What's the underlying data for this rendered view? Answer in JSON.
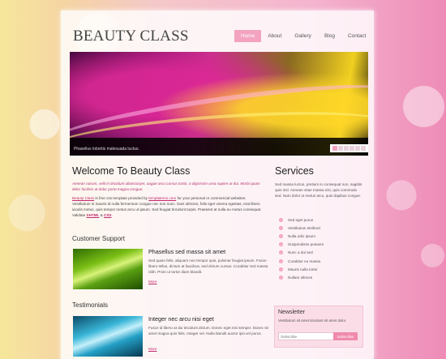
{
  "logo": "BEAUTY CLASS",
  "nav": [
    "Home",
    "About",
    "Gallery",
    "Blog",
    "Contact"
  ],
  "slider": {
    "caption": "Phasellus lobortis malesuada luctus.",
    "active_dot": 1
  },
  "welcome": {
    "title": "Welcome To Beauty Class",
    "intro": "Aenean rutrum, velit in tincidunt ullamcorper, augue arcu cursus tortor, a dignissim urna sapien ut dui. Morbi quam dolor facilisis at dolor porta magna congue.",
    "link1": "Beauty Class",
    "text1": " is free css template provided by ",
    "link2": "templatemo.com",
    "text2": " for your personal or commercial websites. Vestibulum in mauris id nulla fermentum congue nec non nunc. Duis ultricies, felis eget viverra egestas, erat libero iaculis metus, quis tempor metus arcu ut ipsum. Sed feugiat tincidunt turpis. Praesent at nulla eu metus consequat. Validate ",
    "xhtml": "XHTML",
    "amp": " & ",
    "css": "CSS",
    "end": "."
  },
  "customer_support": {
    "heading": "Customer Support",
    "title": "Phasellus sed massa sit amet",
    "text": "Sed quam felis, aliquam non tempor quis, pulvinar feugiat ipsum. Fusce libero tellus, dictum at faucibus, sed dictum cursus. Curabitur sed massa nibh. Proin ut tortor diam blandit.",
    "more": "More"
  },
  "testimonials": {
    "heading": "Testimonials",
    "title": "Integer nec arcu nisi eget",
    "text": "Fusce id libero at dui tincidunt dictum. Donec eget nisi semper. Donec sit amet magna quis felis. Integer vel. Nulla blandit auctor ipsi vel purus.",
    "more": "More"
  },
  "services": {
    "title": "Services",
    "text": "Sed massa luctus, pretium in consequat non, sagittis quis nisl. Aenean vitae massa nisi, quis commodo sed. Nam dolor ut metus arcu, quis dapibus congue.",
    "items": [
      "Sed eget purus",
      "Vestibulum eleifend",
      "Nulla odio ipsum",
      "Suspendisse posuere",
      "Nunc a dui sed",
      "Curabitur eu massa",
      "Mauris nulla tortor",
      "Nullam ultrices"
    ]
  },
  "newsletter": {
    "title": "Newsletter",
    "text": "Vestibulum sit amet tincidunt sit amet dolor.",
    "placeholder": "Subscribe",
    "button": "Subscribe"
  },
  "colors": {
    "accent": "#f3a3bf",
    "link": "#c1296c"
  }
}
